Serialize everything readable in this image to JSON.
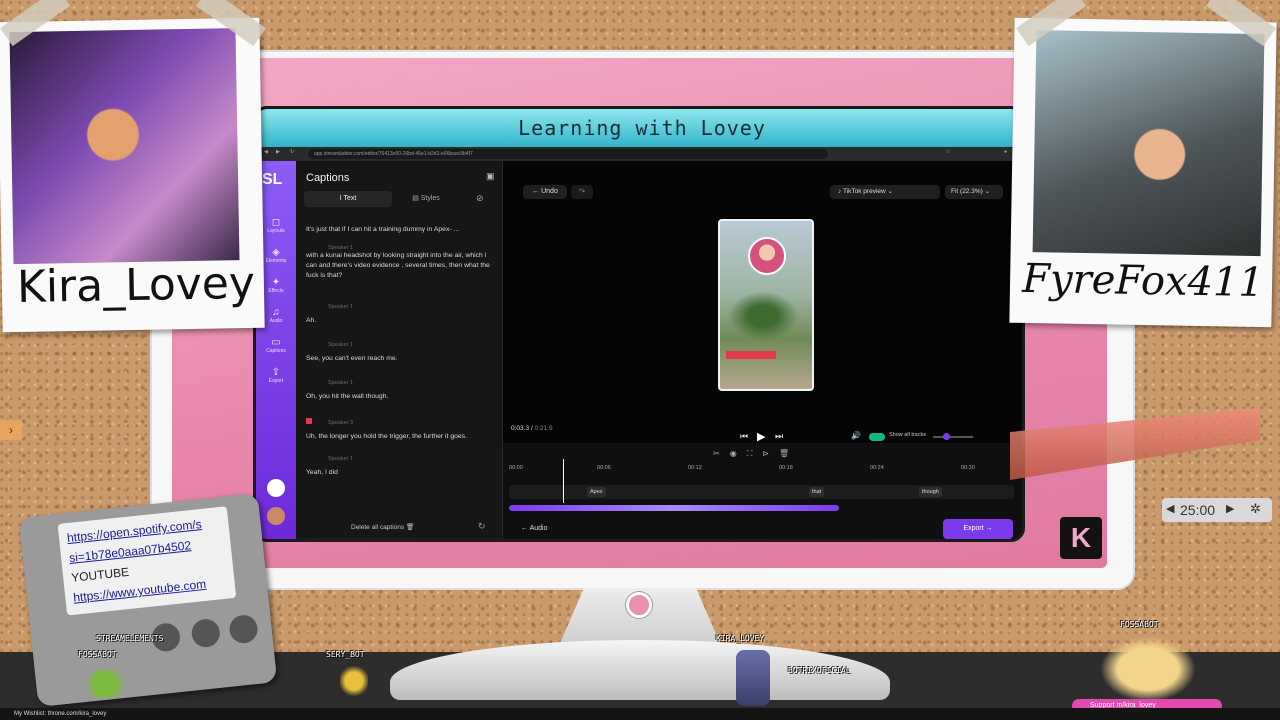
{
  "stream": {
    "banner_title": "Learning with Lovey",
    "left_cam_name": "Kira_Lovey",
    "right_cam_name": "FyreFox411",
    "timer": "25:00",
    "ipod_lines": [
      "https://open.spotify.com/s",
      "si=1b78e0aaa07b4502",
      "YOUTUBE",
      "https://www.youtube.com"
    ],
    "bots": [
      {
        "label": "STREAMELEMENTS"
      },
      {
        "label": "FOSSABOT"
      },
      {
        "label": "SERY_BOT"
      },
      {
        "label": "KIRA_LOVEY"
      },
      {
        "label": "BOTRIXOFICIAL"
      },
      {
        "label": "FOSSABOT"
      }
    ],
    "support_text": "Support",
    "support_handle": "m/kira_lovey",
    "bottom_text": "My Wishlist: throne.com/kira_lovey"
  },
  "browser": {
    "url": "app.streamladder.com/editor/76413e50-26bd-45e1-b2d1-e96baac9b4f7"
  },
  "sidebar": {
    "logo": "SL",
    "items": [
      {
        "label": "Layouts",
        "icon": "layouts-icon",
        "glyph": "◻"
      },
      {
        "label": "Elements",
        "icon": "elements-icon",
        "glyph": "◈"
      },
      {
        "label": "Effects",
        "icon": "effects-icon",
        "glyph": "✦"
      },
      {
        "label": "Audio",
        "icon": "music-icon",
        "glyph": "♫"
      },
      {
        "label": "Captions",
        "icon": "captions-icon",
        "glyph": "▭"
      },
      {
        "label": "Export",
        "icon": "export-icon",
        "glyph": "⇪"
      }
    ]
  },
  "captions": {
    "title": "Captions",
    "tab_text": "Text",
    "tab_styles": "Styles",
    "entries": [
      {
        "speaker": "",
        "text": "It's just that if I can hit a training dummy in Apex- ..."
      },
      {
        "speaker": "Speaker 1",
        "text": "with a kunai headshot by looking straight into the air, which I can and there's video evidence , several times, then what the fuck is that?"
      },
      {
        "speaker": "Speaker 1",
        "text": "Ah."
      },
      {
        "speaker": "Speaker 1",
        "text": "See, you can't even reach me."
      },
      {
        "speaker": "Speaker 1",
        "text": "Oh, you hit the wall though."
      },
      {
        "speaker": "Speaker 3",
        "text": "Uh, the longer you hold the trigger, the further it goes."
      },
      {
        "speaker": "Speaker 1",
        "text": "Yeah, I did"
      }
    ],
    "delete_all": "Delete all captions"
  },
  "editor": {
    "undo": "Undo",
    "preview_mode": "TikTok preview",
    "fit": "Fit (22.3%)",
    "current_time": "0:03.3",
    "total_time": "0:21.9",
    "show_all_tracks": "Show all tracks",
    "ticks": [
      "00:00",
      "00:06",
      "00:12",
      "00:18",
      "00:24",
      "00:30"
    ],
    "caption_chips": [
      "Apex",
      "that",
      "though"
    ],
    "audio_label": "Audio",
    "export_label": "Export"
  },
  "colors": {
    "accent": "#7c3aed",
    "toggle_on": "#10b981",
    "monitor_pink": "#e98fb0"
  }
}
